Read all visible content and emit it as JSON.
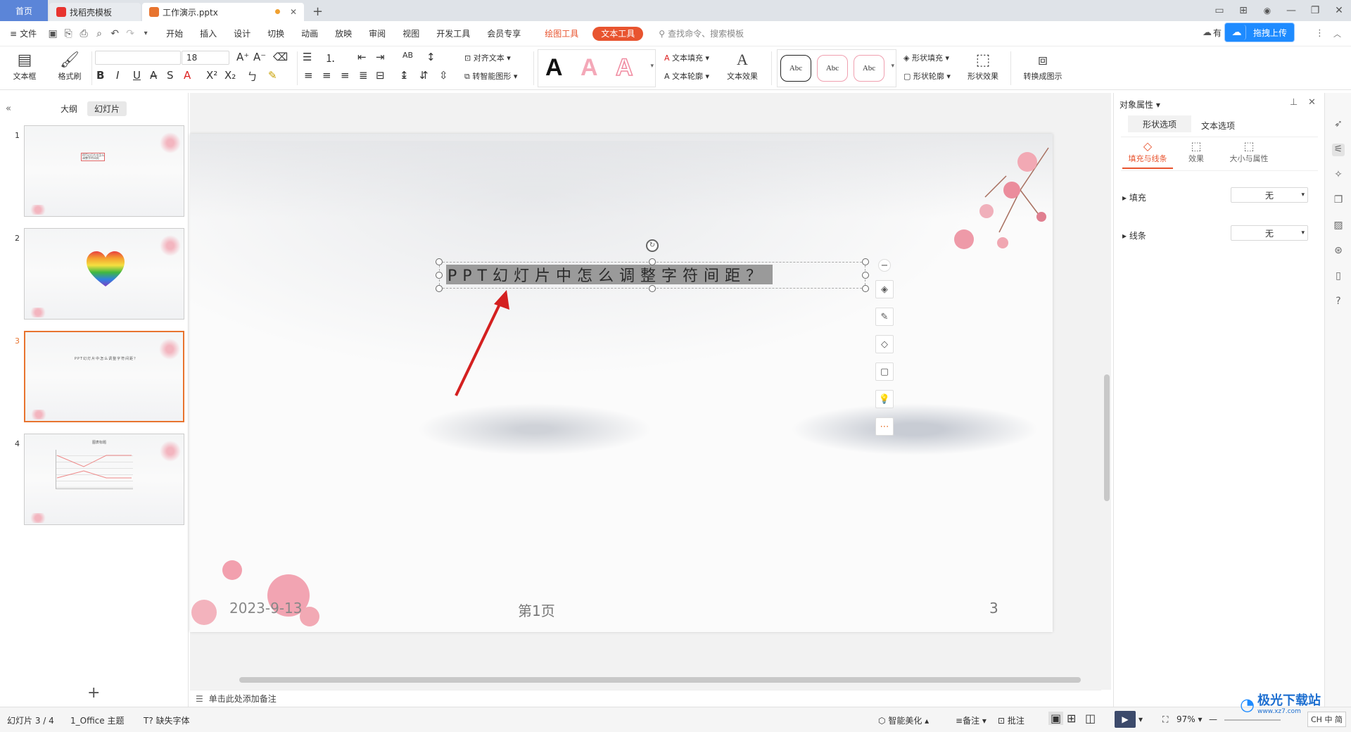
{
  "tabs": {
    "home": "首页",
    "template": "找稻壳模板",
    "doc": "工作演示.pptx"
  },
  "menu": {
    "file": "文件",
    "items": [
      "开始",
      "插入",
      "设计",
      "切换",
      "动画",
      "放映",
      "审阅",
      "视图",
      "开发工具",
      "会员专享"
    ],
    "draw_tool": "绘图工具",
    "text_tool": "文本工具",
    "search_placeholder": "查找命令、搜索模板",
    "upload_prefix": "有",
    "upload": "拖拽上传"
  },
  "toolbar": {
    "textbox": "文本框",
    "format_painter": "格式刷",
    "font_size": "18",
    "align_text": "对齐文本",
    "smart_shape": "转智能图形",
    "text_fill": "文本填充",
    "text_outline": "文本轮廓",
    "text_effect": "文本效果",
    "abc": "Abc",
    "shape_fill": "形状填充",
    "shape_outline": "形状轮廓",
    "shape_effect": "形状效果",
    "convert_diagram": "转换成图示"
  },
  "left_panel": {
    "outline_tab": "大纲",
    "slides_tab": "幻灯片",
    "slides": [
      {
        "num": "1",
        "title": "PPT幻灯片中怎么调整字符间距"
      },
      {
        "num": "2",
        "title": ""
      },
      {
        "num": "3",
        "title": "PPT幻灯片中怎么调整字符间距？"
      },
      {
        "num": "4",
        "title": "图表标题"
      }
    ]
  },
  "slide": {
    "title": "PPT幻灯片中怎么调整字符间距？",
    "date": "2023-9-13",
    "page_label": "第1页",
    "page_num": "3"
  },
  "notes_placeholder": "单击此处添加备注",
  "right_panel": {
    "title": "对象属性",
    "tab_shape": "形状选项",
    "tab_text": "文本选项",
    "sub_fill_line": "填充与线条",
    "sub_effect": "效果",
    "sub_size": "大小与属性",
    "fill_label": "填充",
    "fill_value": "无",
    "line_label": "线条",
    "line_value": "无"
  },
  "status": {
    "slide_count": "幻灯片 3 / 4",
    "theme": "1_Office 主题",
    "missing_font": "缺失字体",
    "beautify": "智能美化",
    "notes": "备注",
    "comments": "批注",
    "zoom": "97%",
    "ime": "CH 中 简"
  },
  "watermark": {
    "site": "极光下载站",
    "url": "www.xz7.com"
  },
  "colors": {
    "accent": "#e8542f",
    "tab_blue": "#5b85d8",
    "selected_thumb": "#e8742f",
    "arrow": "#d42020"
  }
}
